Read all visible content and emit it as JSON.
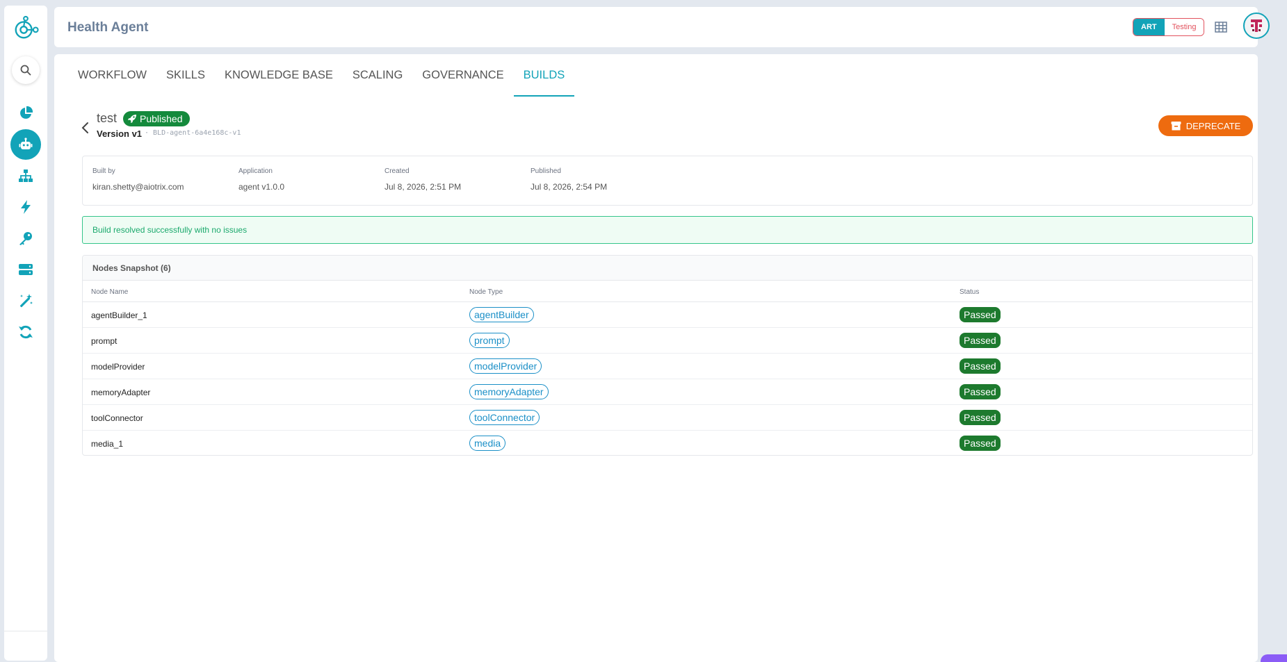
{
  "header": {
    "title": "Health Agent",
    "env_on": "ART",
    "env_off": "Testing"
  },
  "sidebar": {
    "items": [
      {
        "icon": "pie-chart-icon"
      },
      {
        "icon": "robot-icon",
        "active": true
      },
      {
        "icon": "hierarchy-icon"
      },
      {
        "icon": "bolt-icon"
      },
      {
        "icon": "key-icon"
      },
      {
        "icon": "server-icon"
      },
      {
        "icon": "magic-wand-icon"
      },
      {
        "icon": "sync-icon"
      }
    ]
  },
  "tabs": [
    {
      "label": "WORKFLOW"
    },
    {
      "label": "SKILLS"
    },
    {
      "label": "KNOWLEDGE BASE"
    },
    {
      "label": "SCALING"
    },
    {
      "label": "GOVERNANCE"
    },
    {
      "label": "BUILDS",
      "active": true
    }
  ],
  "build": {
    "name": "test",
    "status_badge": "Published",
    "version": "Version v1",
    "id": "· BLD-agent-6a4e168c-v1",
    "deprecate_label": "DEPRECATE"
  },
  "info": {
    "built_by_label": "Built by",
    "built_by": "kiran.shetty@aiotrix.com",
    "application_label": "Application",
    "application": "agent v1.0.0",
    "created_label": "Created",
    "created": "Jul 8, 2026, 2:51 PM",
    "published_label": "Published",
    "published": "Jul 8, 2026, 2:54 PM"
  },
  "banner": "Build resolved successfully with no issues",
  "nodes": {
    "title": "Nodes Snapshot (6)",
    "columns": {
      "name": "Node Name",
      "type": "Node Type",
      "status": "Status"
    },
    "rows": [
      {
        "name": "agentBuilder_1",
        "type": "agentBuilder",
        "status": "Passed"
      },
      {
        "name": "prompt",
        "type": "prompt",
        "status": "Passed"
      },
      {
        "name": "modelProvider",
        "type": "modelProvider",
        "status": "Passed"
      },
      {
        "name": "memoryAdapter",
        "type": "memoryAdapter",
        "status": "Passed"
      },
      {
        "name": "toolConnector",
        "type": "toolConnector",
        "status": "Passed"
      },
      {
        "name": "media_1",
        "type": "media",
        "status": "Passed"
      }
    ]
  },
  "colors": {
    "accent": "#12a3b8",
    "published": "#148a3c",
    "deprecate": "#ee6b0f",
    "passed": "#1d7a2e",
    "type_pill": "#1a8fc7"
  }
}
